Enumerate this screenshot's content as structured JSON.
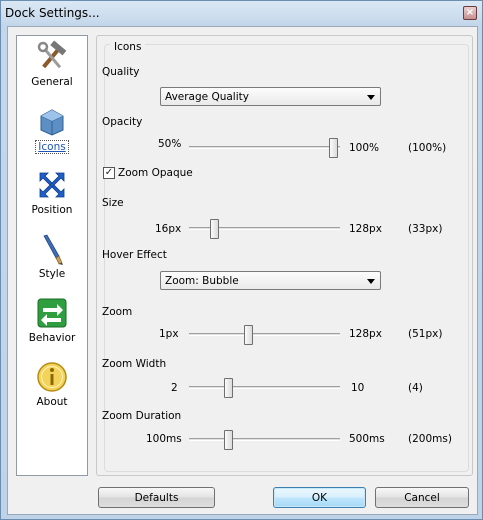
{
  "window": {
    "title": "Dock Settings...",
    "close_glyph": "×"
  },
  "sidebar": {
    "items": [
      {
        "label": "General",
        "icon": "tools-icon"
      },
      {
        "label": "Icons",
        "icon": "icons-icon",
        "selected": true
      },
      {
        "label": "Position",
        "icon": "position-arrows-icon"
      },
      {
        "label": "Style",
        "icon": "brush-icon"
      },
      {
        "label": "Behavior",
        "icon": "behavior-arrows-icon"
      },
      {
        "label": "About",
        "icon": "info-icon"
      }
    ]
  },
  "icons_group": {
    "title": "Icons",
    "quality": {
      "label": "Quality",
      "selected": "Average Quality"
    },
    "opacity": {
      "label": "Opacity",
      "min_label": "50%",
      "max_label": "100%",
      "current": "(100%)",
      "fraction": 1.0
    },
    "zoom_opaque": {
      "label": "Zoom Opaque",
      "checked": true
    },
    "size": {
      "label": "Size",
      "min_label": "16px",
      "max_label": "128px",
      "current": "(33px)",
      "fraction": 0.15
    },
    "hover_effect": {
      "label": "Hover Effect",
      "selected": "Zoom: Bubble"
    },
    "zoom": {
      "label": "Zoom",
      "min_label": "1px",
      "max_label": "128px",
      "current": "(51px)",
      "fraction": 0.39
    },
    "zoom_width": {
      "label": "Zoom Width",
      "min_label": "2",
      "max_label": "10",
      "current": "(4)",
      "fraction": 0.25
    },
    "zoom_duration": {
      "label": "Zoom Duration",
      "min_label": "100ms",
      "max_label": "500ms",
      "current": "(200ms)",
      "fraction": 0.25
    }
  },
  "buttons": {
    "defaults": "Defaults",
    "ok": "OK",
    "cancel": "Cancel"
  },
  "colors": {
    "selected_label": "#1f55b4",
    "titlebar": "#c4d7ea"
  }
}
